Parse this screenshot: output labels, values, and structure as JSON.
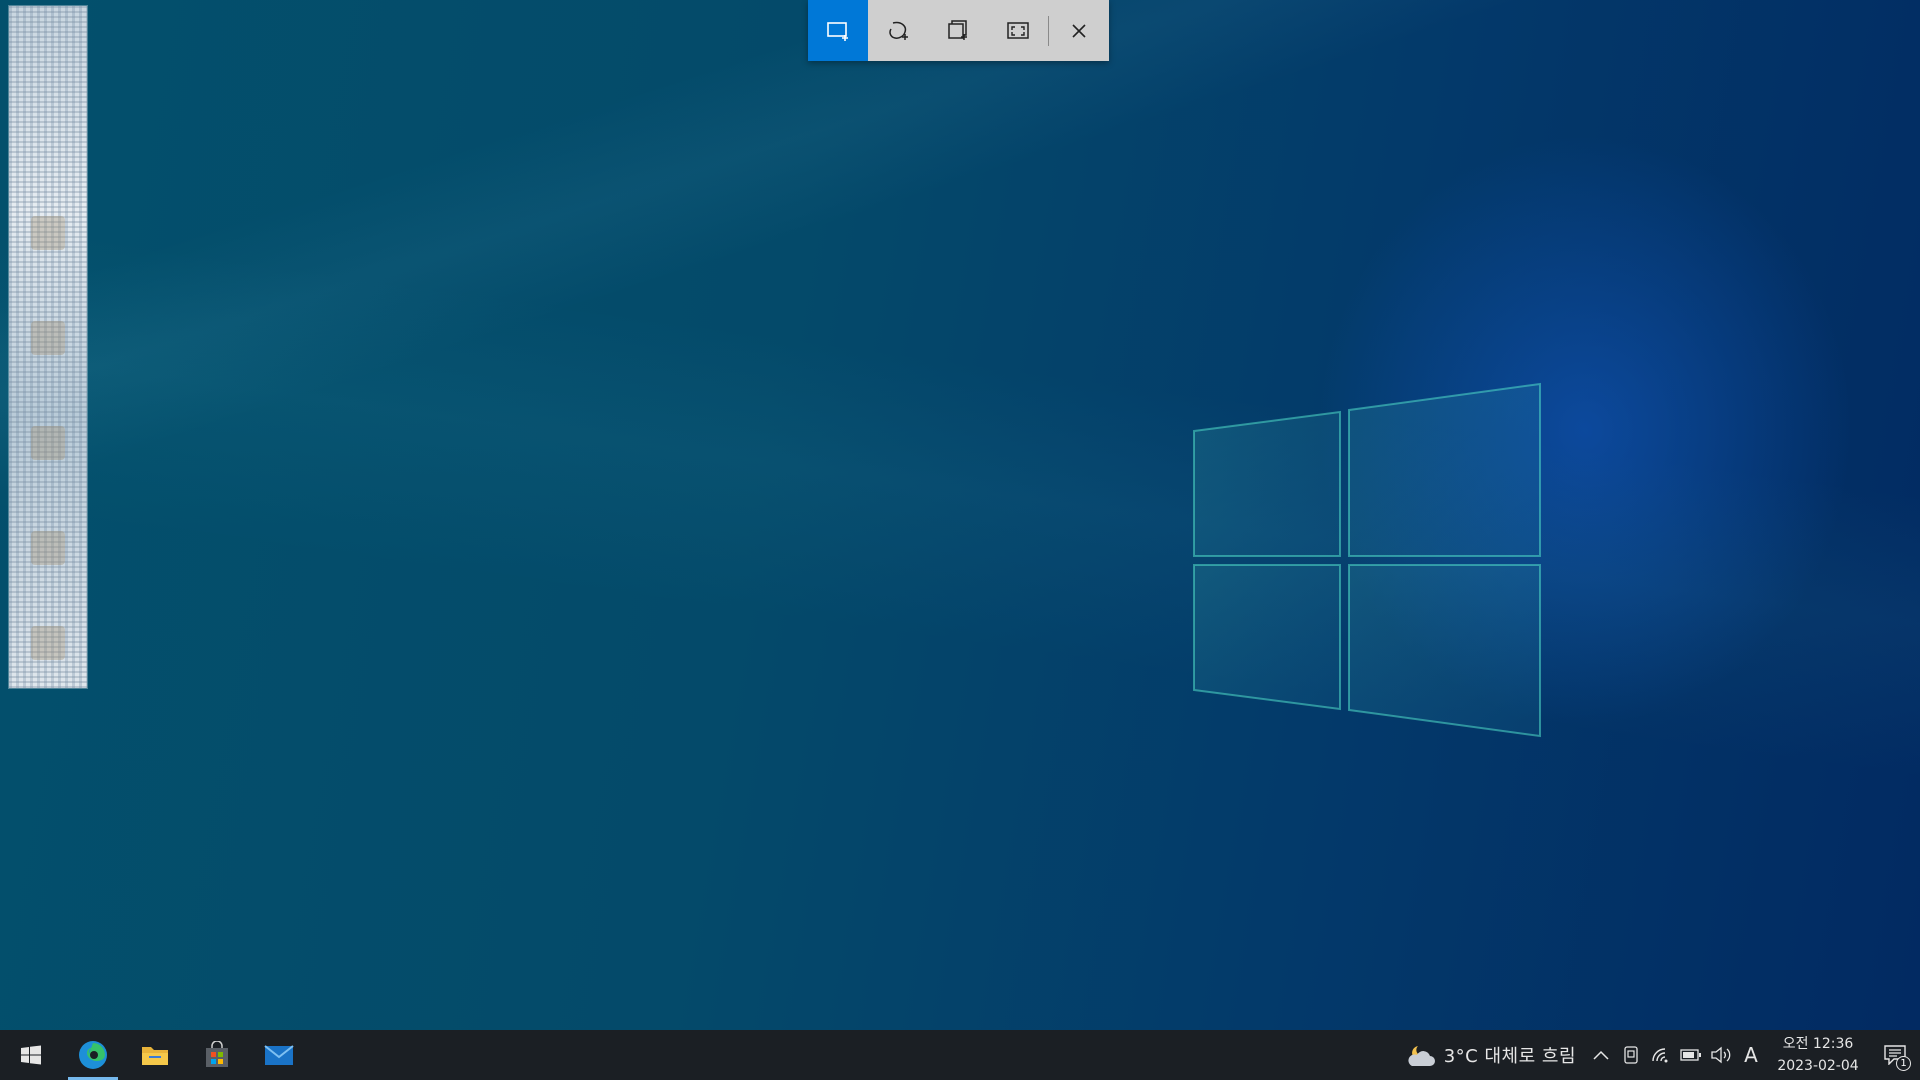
{
  "snip_toolbar": {
    "buttons": [
      {
        "icon": "rectangular-snip-icon",
        "active": true
      },
      {
        "icon": "freeform-snip-icon",
        "active": false
      },
      {
        "icon": "window-snip-icon",
        "active": false
      },
      {
        "icon": "fullscreen-snip-icon",
        "active": false
      },
      {
        "icon": "close-icon",
        "active": false
      }
    ],
    "accent_color": "#0078d7"
  },
  "taskbar": {
    "apps": [
      {
        "name": "start",
        "icon": "windows-start-icon"
      },
      {
        "name": "edge",
        "icon": "edge-icon",
        "running": true
      },
      {
        "name": "file-explorer",
        "icon": "folder-icon"
      },
      {
        "name": "microsoft-store",
        "icon": "store-icon"
      },
      {
        "name": "mail",
        "icon": "mail-icon"
      }
    ],
    "weather": {
      "icon": "cloudy-night-icon",
      "text": "3°C  대체로 흐림"
    },
    "tray_icons": [
      "chevron-up-icon",
      "touch-keyboard-icon",
      "wifi-icon",
      "battery-icon",
      "volume-icon"
    ],
    "ime": "A",
    "clock": {
      "time": "오전 12:36",
      "date": "2023-02-04"
    },
    "notifications": "1"
  }
}
